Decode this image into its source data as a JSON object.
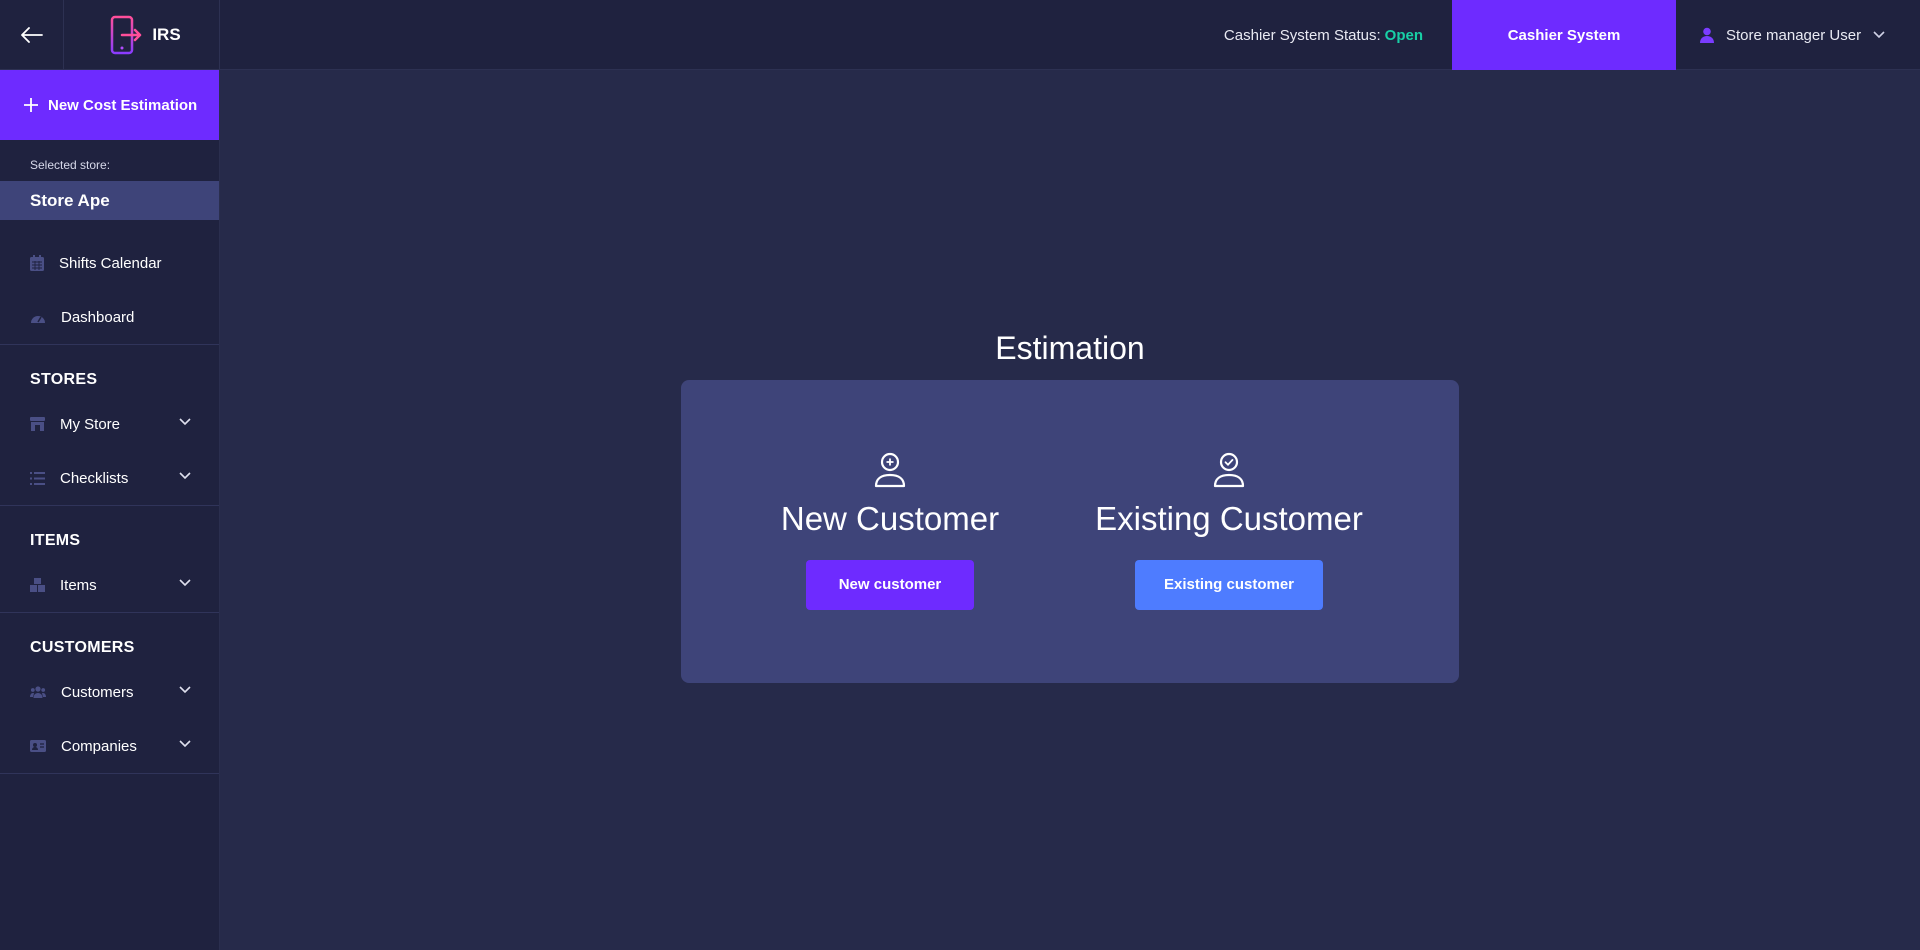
{
  "header": {
    "app_name": "IRS",
    "status_label": "Cashier System Status:",
    "status_value": "Open",
    "cashier_button": "Cashier System",
    "user_name": "Store manager User"
  },
  "sidebar": {
    "new_estimation_label": "New Cost Estimation",
    "selected_store_label": "Selected store:",
    "selected_store_name": "Store Ape",
    "top_items": [
      {
        "label": "Shifts Calendar",
        "icon": "calendar-icon"
      },
      {
        "label": "Dashboard",
        "icon": "dashboard-gauge-icon"
      }
    ],
    "sections": [
      {
        "title": "STORES",
        "items": [
          {
            "label": "My Store",
            "icon": "store-icon"
          },
          {
            "label": "Checklists",
            "icon": "list-icon"
          }
        ]
      },
      {
        "title": "ITEMS",
        "items": [
          {
            "label": "Items",
            "icon": "boxes-icon"
          }
        ]
      },
      {
        "title": "CUSTOMERS",
        "items": [
          {
            "label": "Customers",
            "icon": "users-icon"
          },
          {
            "label": "Companies",
            "icon": "id-card-icon"
          }
        ]
      }
    ]
  },
  "main": {
    "title": "Estimation",
    "new_customer": {
      "heading": "New Customer",
      "button": "New customer"
    },
    "existing_customer": {
      "heading": "Existing Customer",
      "button": "Existing customer"
    }
  },
  "colors": {
    "accent": "#6e2bff",
    "secondary_button": "#4e7cff",
    "status_open": "#18d0a6",
    "background": "#262a4a",
    "panel": "#3e4479"
  }
}
